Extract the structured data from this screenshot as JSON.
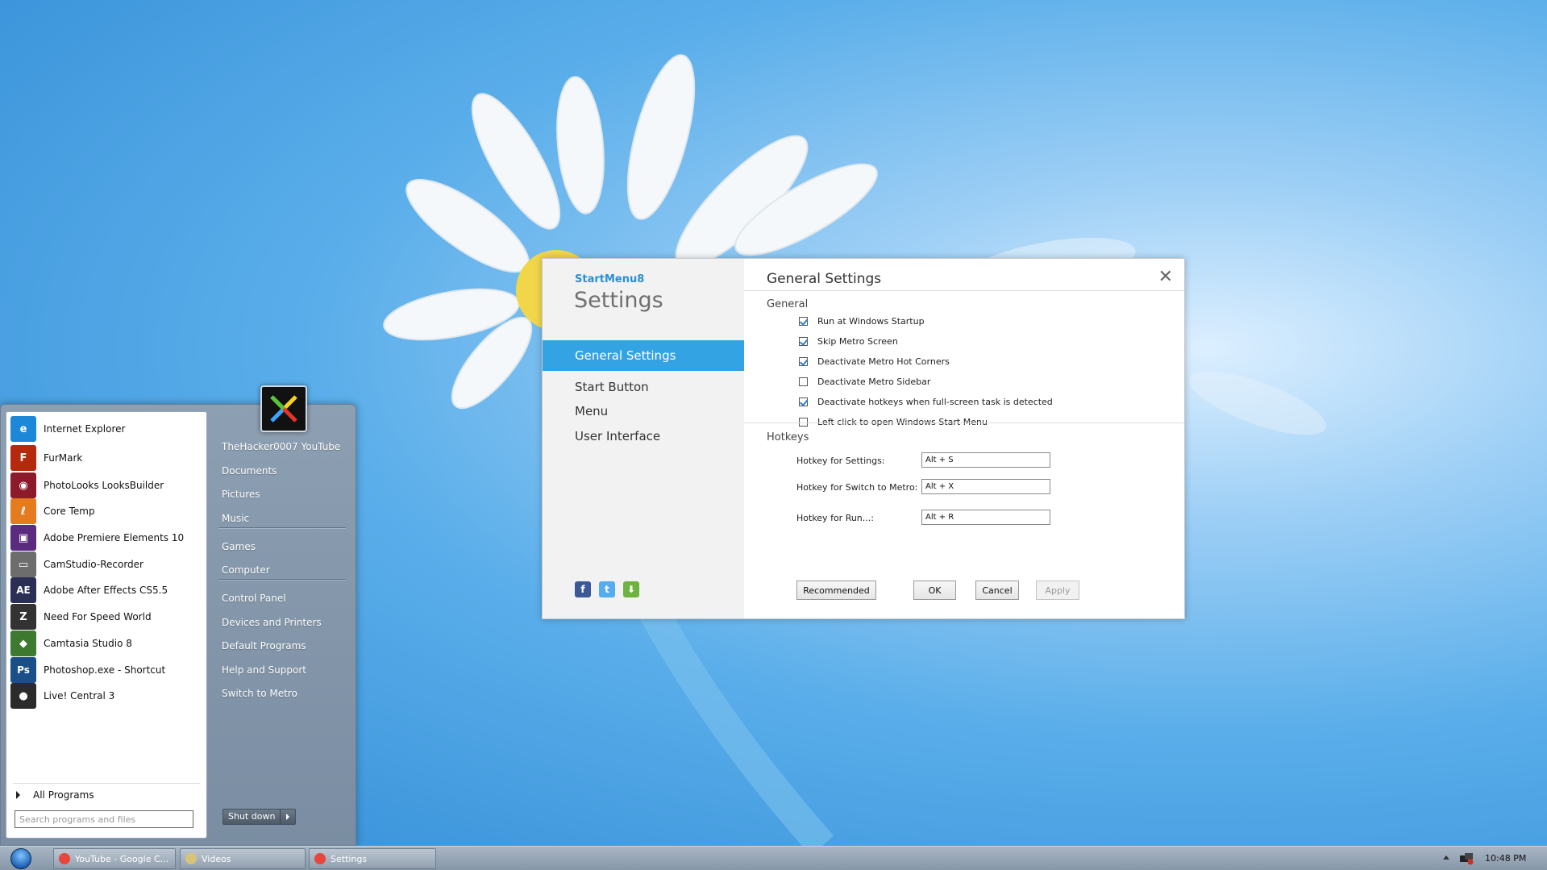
{
  "start_menu": {
    "programs": [
      {
        "label": "Internet Explorer",
        "icon": "internet-explorer-icon",
        "color": "#1e88d8",
        "glyph": "e"
      },
      {
        "label": "FurMark",
        "icon": "furmark-icon",
        "color": "#b52a0c",
        "glyph": "F"
      },
      {
        "label": "PhotoLooks LooksBuilder",
        "icon": "photolooks-icon",
        "color": "#8b1b2a",
        "glyph": "◉"
      },
      {
        "label": "Core Temp",
        "icon": "core-temp-icon",
        "color": "#e47b1e",
        "glyph": "ℓ"
      },
      {
        "label": "Adobe Premiere Elements 10",
        "icon": "premiere-elements-icon",
        "color": "#5b2b80",
        "glyph": "▣"
      },
      {
        "label": "CamStudio-Recorder",
        "icon": "camstudio-icon",
        "color": "#6d6d6d",
        "glyph": "▭"
      },
      {
        "label": "Adobe After Effects CS5.5",
        "icon": "after-effects-icon",
        "color": "#2c2f55",
        "glyph": "AE"
      },
      {
        "label": "Need For Speed World",
        "icon": "nfs-world-icon",
        "color": "#333333",
        "glyph": "Z"
      },
      {
        "label": "Camtasia Studio 8",
        "icon": "camtasia-icon",
        "color": "#3d7a2f",
        "glyph": "◆"
      },
      {
        "label": "Photoshop.exe - Shortcut",
        "icon": "photoshop-icon",
        "color": "#1b4f8a",
        "glyph": "Ps"
      },
      {
        "label": "Live! Central 3",
        "icon": "live-central-icon",
        "color": "#2b2b2b",
        "glyph": "●"
      }
    ],
    "all_programs": "All Programs",
    "search_placeholder": "Search programs and files",
    "right_items": [
      "TheHacker0007 YouTube",
      "Documents",
      "Pictures",
      "Music",
      "Games",
      "Computer",
      "Control Panel",
      "Devices and Printers",
      "Default Programs",
      "Help and Support",
      "Switch to Metro"
    ],
    "shutdown_label": "Shut down"
  },
  "settings": {
    "brand": "StartMenu8",
    "title": "Settings",
    "nav": [
      "General Settings",
      "Start Button",
      "Menu",
      "User Interface"
    ],
    "active_nav": 0,
    "panel_title": "General Settings",
    "close_glyph": "✕",
    "general_label": "General",
    "options": [
      {
        "label": "Run at Windows Startup",
        "checked": true
      },
      {
        "label": "Skip Metro Screen",
        "checked": true
      },
      {
        "label": "Deactivate Metro Hot Corners",
        "checked": true
      },
      {
        "label": "Deactivate Metro Sidebar",
        "checked": false
      },
      {
        "label": "Deactivate hotkeys when full-screen task is detected",
        "checked": true
      },
      {
        "label": "Left click to open Windows Start Menu",
        "checked": false
      }
    ],
    "hotkeys_label": "Hotkeys",
    "hotkeys": [
      {
        "label": "Hotkey for Settings:",
        "value": "Alt + S"
      },
      {
        "label": "Hotkey for Switch to Metro:",
        "value": "Alt + X"
      },
      {
        "label": "Hotkey for Run...:",
        "value": "Alt + R"
      }
    ],
    "buttons": {
      "recommended": "Recommended",
      "ok": "OK",
      "cancel": "Cancel",
      "apply": "Apply"
    },
    "social": [
      {
        "icon": "facebook-icon",
        "color": "#3b5998",
        "glyph": "f"
      },
      {
        "icon": "twitter-icon",
        "color": "#55acee",
        "glyph": "t"
      },
      {
        "icon": "download-icon",
        "color": "#6db33f",
        "glyph": "⬇"
      }
    ]
  },
  "taskbar": {
    "items": [
      {
        "label": "YouTube - Google C...",
        "icon": "chrome-icon",
        "color": "#e8453c"
      },
      {
        "label": "Videos",
        "icon": "videos-folder-icon",
        "color": "#d9c27a"
      },
      {
        "label": "Settings",
        "icon": "settings-app-icon",
        "color": "#e8453c"
      }
    ],
    "clock": "10:48 PM"
  },
  "colors": {
    "accent": "#33a3e4",
    "brand": "#2a8fd6"
  }
}
